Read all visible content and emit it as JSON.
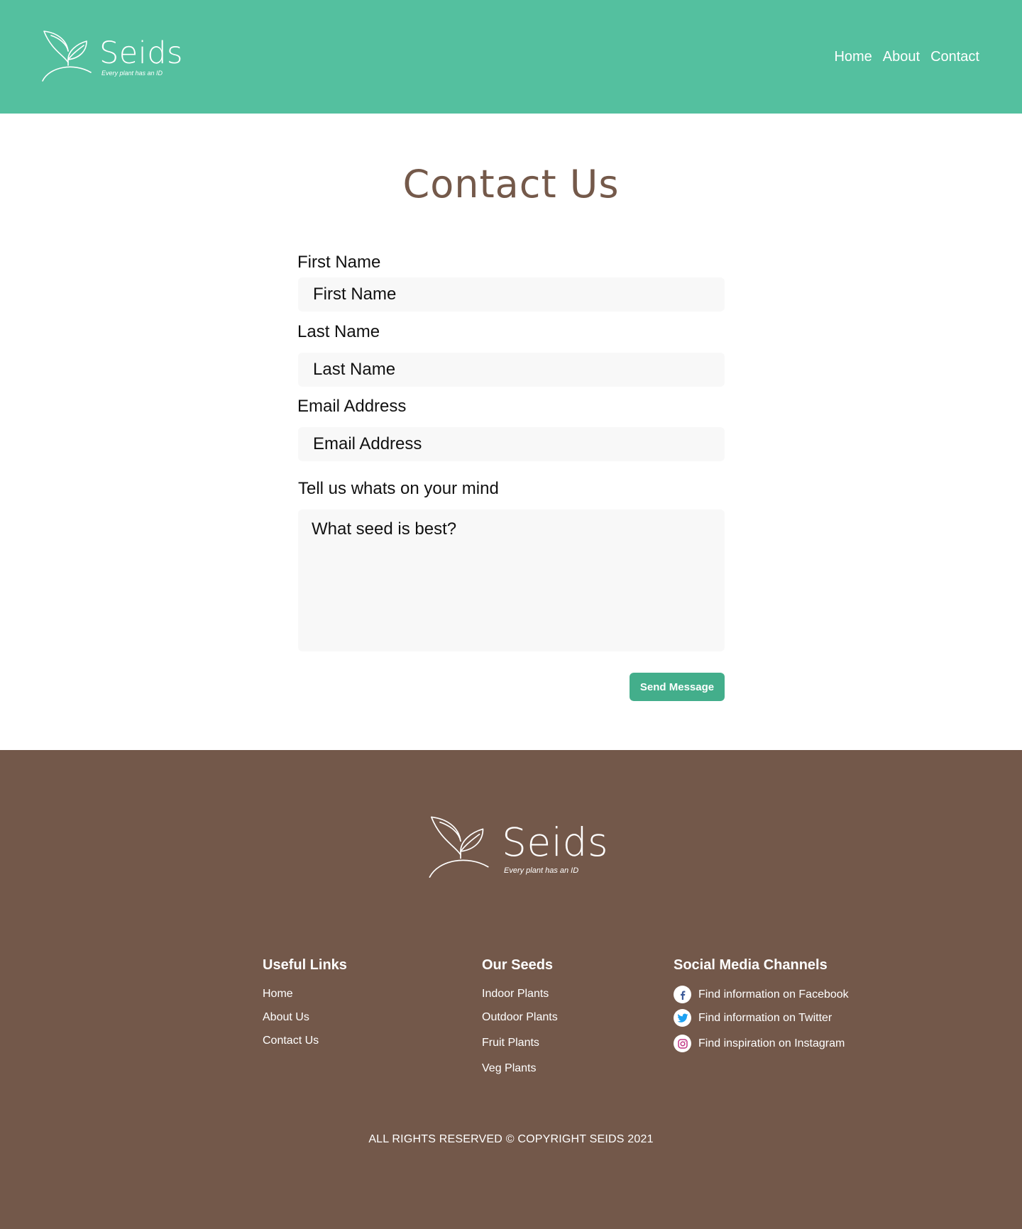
{
  "header": {
    "brand": "Seids",
    "tagline": "Every plant has an ID",
    "nav": [
      "Home",
      "About",
      "Contact"
    ]
  },
  "main": {
    "title": "Contact Us",
    "fields": {
      "first_name": {
        "label": "First Name",
        "placeholder": "First Name",
        "value": ""
      },
      "last_name": {
        "label": "Last Name",
        "placeholder": "Last Name",
        "value": ""
      },
      "email": {
        "label": "Email Address",
        "placeholder": "Email Address",
        "value": ""
      },
      "message": {
        "label": "Tell us whats on your mind",
        "placeholder": "What seed is best?",
        "value": ""
      }
    },
    "submit_label": "Send Message"
  },
  "footer": {
    "brand": "Seids",
    "tagline": "Every plant has an ID",
    "useful_links": {
      "heading": "Useful Links",
      "items": [
        "Home",
        "About Us",
        "Contact Us"
      ]
    },
    "our_seeds": {
      "heading": "Our Seeds",
      "items": [
        "Indoor Plants",
        "Outdoor Plants",
        "Fruit Plants",
        "Veg Plants"
      ]
    },
    "social": {
      "heading": "Social Media Channels",
      "items": [
        {
          "icon": "facebook-icon",
          "text": "Find information on Facebook"
        },
        {
          "icon": "twitter-icon",
          "text": "Find information on Twitter"
        },
        {
          "icon": "instagram-icon",
          "text": "Find inspiration on Instagram"
        }
      ]
    },
    "copyright": "ALL RIGHTS RESERVED © COPYRIGHT SEIDS 2021"
  },
  "colors": {
    "header_bg": "#54c09f",
    "button_bg": "#43ae8b",
    "title": "#74594a",
    "footer_bg": "#73584a",
    "input_bg": "#f8f8f8",
    "facebook": "#3b5998",
    "twitter": "#1da1f2",
    "instagram": "#c13584"
  }
}
